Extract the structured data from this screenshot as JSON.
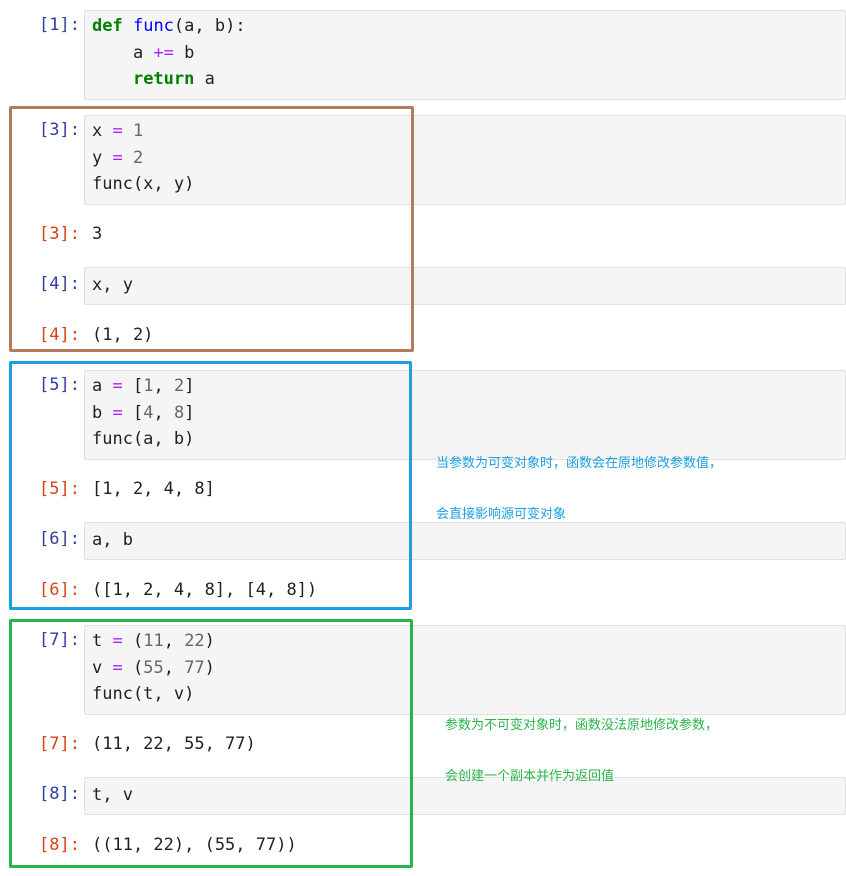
{
  "cells": {
    "c1": {
      "in_prompt": "[1]:",
      "line1": [
        "def",
        " ",
        "func",
        "(a, b):"
      ],
      "line2": [
        "    a ",
        "+=",
        " b"
      ],
      "line3": [
        "    ",
        "return",
        " a"
      ]
    },
    "c3": {
      "in_prompt": "[3]:",
      "l1": [
        "x ",
        "=",
        " ",
        "1"
      ],
      "l2": [
        "y ",
        "=",
        " ",
        "2"
      ],
      "l3": "func(x, y)",
      "out_prompt": "[3]:",
      "out": "3"
    },
    "c4": {
      "in_prompt": "[4]:",
      "code": "x, y",
      "out_prompt": "[4]:",
      "out": "(1, 2)"
    },
    "c5": {
      "in_prompt": "[5]:",
      "l1": [
        "a ",
        "=",
        " [",
        "1",
        ", ",
        "2",
        "]"
      ],
      "l2": [
        "b ",
        "=",
        " [",
        "4",
        ", ",
        "8",
        "]"
      ],
      "l3": "func(a, b)",
      "out_prompt": "[5]:",
      "out": "[1, 2, 4, 8]"
    },
    "c6": {
      "in_prompt": "[6]:",
      "code": "a, b",
      "out_prompt": "[6]:",
      "out": "([1, 2, 4, 8], [4, 8])"
    },
    "c7": {
      "in_prompt": "[7]:",
      "l1": [
        "t ",
        "=",
        " (",
        "11",
        ", ",
        "22",
        ")"
      ],
      "l2": [
        "v ",
        "=",
        " (",
        "55",
        ", ",
        "77",
        ")"
      ],
      "l3": "func(t, v)",
      "out_prompt": "[7]:",
      "out": "(11, 22, 55, 77)"
    },
    "c8": {
      "in_prompt": "[8]:",
      "code": "t, v",
      "out_prompt": "[8]:",
      "out": "((11, 22), (55, 77))"
    }
  },
  "annotations": {
    "mutable": {
      "line1": "当参数为可变对象时，函数会在原地修改参数值，",
      "line2": "会直接影响源可变对象",
      "color": "#1a9fe0"
    },
    "immutable": {
      "line1": "参数为不可变对象时，函数没法原地修改参数，",
      "line2": "会创建一个副本并作为返回值",
      "color": "#2bb44a"
    }
  },
  "colors": {
    "box_brown": "#b57c5c",
    "box_blue": "#1a9fe0",
    "box_green": "#2bb44a"
  }
}
